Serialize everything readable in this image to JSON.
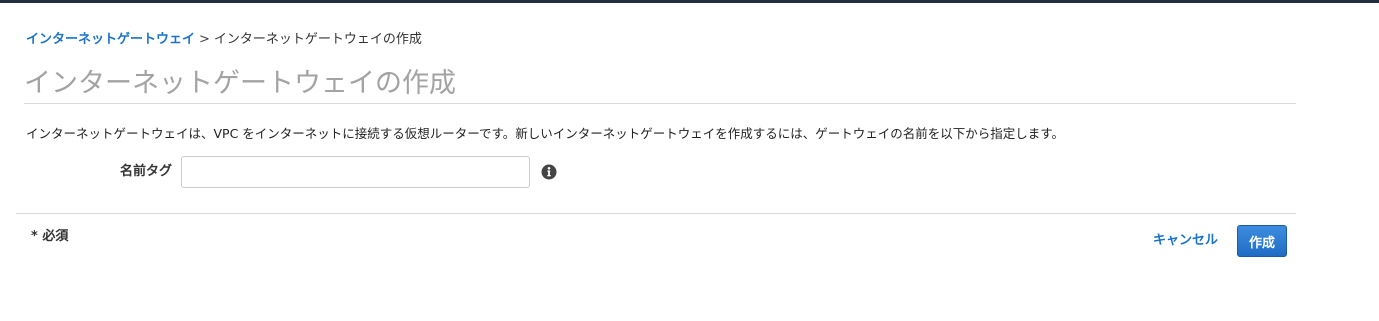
{
  "breadcrumb": {
    "parent": "インターネットゲートウェイ",
    "separator": ">",
    "current": "インターネットゲートウェイの作成"
  },
  "page": {
    "title": "インターネットゲートウェイの作成",
    "description": "インターネットゲートウェイは、VPC をインターネットに接続する仮想ルーターです。新しいインターネットゲートウェイを作成するには、ゲートウェイの名前を以下から指定します。"
  },
  "form": {
    "name_tag_label": "名前タグ",
    "name_tag_value": "",
    "name_tag_placeholder": "",
    "info_icon": "info-circle-icon"
  },
  "footer": {
    "required_note": "* 必須",
    "cancel_label": "キャンセル",
    "create_label": "作成"
  },
  "colors": {
    "link": "#1a73c8",
    "primary_button": "#1f6cc4",
    "title": "#a3a3a3",
    "top_bar": "#232f3e"
  }
}
